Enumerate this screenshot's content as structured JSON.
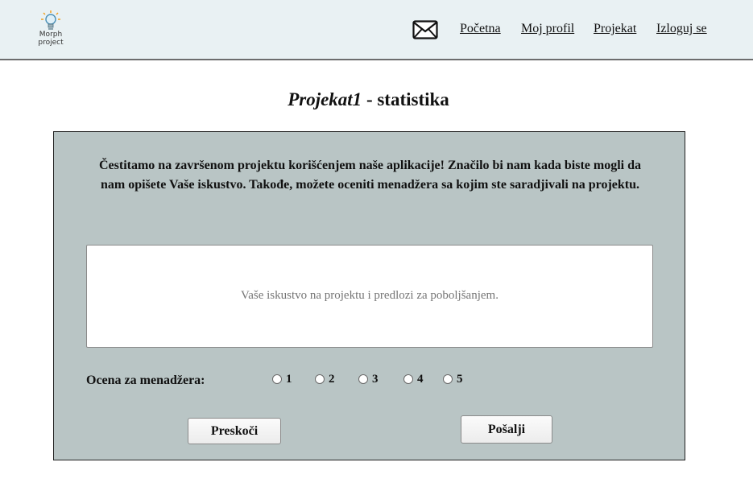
{
  "header": {
    "logo_line1": "Morph",
    "logo_line2": "project",
    "nav": {
      "home": "Početna",
      "profile": "Moj profil",
      "project": "Projekat",
      "logout": "Izloguj se"
    }
  },
  "page": {
    "title_italic": "Projekat1",
    "title_rest": " - statistika"
  },
  "panel": {
    "message": "Čestitamo na završenom projektu korišćenjem naše aplikacije! Značilo bi nam kada biste mogli da nam opišete Vaše iskustvo. Takođe, možete oceniti menadžera sa kojim ste saradjivali na projektu.",
    "feedback_placeholder": "Vaše iskustvo na projektu i predlozi za poboljšanjem.",
    "rating_label": "Ocena za menadžera:",
    "rating_options": [
      "1",
      "2",
      "3",
      "4",
      "5"
    ],
    "skip_label": "Preskoči",
    "submit_label": "Pošalji"
  },
  "colors": {
    "header_bg": "#e9f1f3",
    "panel_bg": "#b9c5c5"
  }
}
